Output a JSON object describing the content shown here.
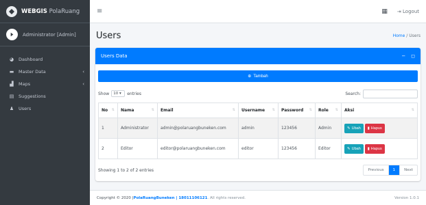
{
  "brand": {
    "bold": "WEBGIS",
    "light": " PolaRuang"
  },
  "user": {
    "name": "Administrator [Admin]"
  },
  "sidebar": {
    "items": [
      {
        "icon": "dashboard-icon",
        "label": "Dashboard",
        "has_arrow": false
      },
      {
        "icon": "database-icon",
        "label": "Master Data",
        "has_arrow": true
      },
      {
        "icon": "map-icon",
        "label": "Maps",
        "has_arrow": true
      },
      {
        "icon": "comment-icon",
        "label": "Suggestions",
        "has_arrow": false
      },
      {
        "icon": "users-icon",
        "label": "Users",
        "has_arrow": false
      }
    ]
  },
  "topbar": {
    "logout_label": "Logout"
  },
  "page": {
    "title": "Users",
    "breadcrumb_home": "Home",
    "breadcrumb_sep": " / ",
    "breadcrumb_current": "Users"
  },
  "card": {
    "title": "Users Data",
    "add_button": "Tambah"
  },
  "table_controls": {
    "show_label": "Show",
    "show_value": "10",
    "entries_label": "entries",
    "search_label": "Search:"
  },
  "table": {
    "columns": [
      "No",
      "Nama",
      "Email",
      "Username",
      "Password",
      "Role",
      "Aksi"
    ],
    "rows": [
      {
        "no": "1",
        "nama": "Administrator",
        "email": "admin@polaruangbuneken.com",
        "username": "admin",
        "password": "123456",
        "role": "Admin"
      },
      {
        "no": "2",
        "nama": "Editor",
        "email": "editor@polaruangbuneken.com",
        "username": "editor",
        "password": "123456",
        "role": "Editor"
      }
    ],
    "edit_label": "Ubah",
    "delete_label": "Hapus"
  },
  "table_info": "Showing 1 to 2 of 2 entries",
  "pagination": {
    "previous": "Previous",
    "page": "1",
    "next": "Next"
  },
  "footer": {
    "prefix": "Copyright © 2020 | ",
    "link": "PolaRuangBuneken | 18011106121",
    "suffix": ". All rights reserved.",
    "version": "Version 1.0.1"
  },
  "colors": {
    "primary": "#007bff",
    "sidebar": "#343a40",
    "info": "#17a2b8",
    "danger": "#dc3545"
  }
}
